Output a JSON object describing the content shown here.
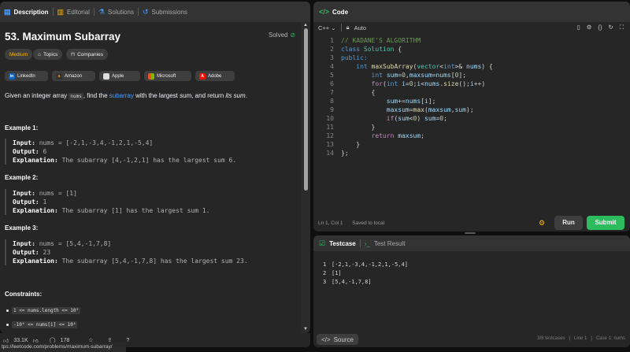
{
  "left_tabs": [
    {
      "label": "Description",
      "icon": "document-icon"
    },
    {
      "label": "Editorial",
      "icon": "book-icon"
    },
    {
      "label": "Solutions",
      "icon": "flask-icon"
    },
    {
      "label": "Submissions",
      "icon": "history-icon"
    }
  ],
  "problem": {
    "title": "53. Maximum Subarray",
    "status": "Solved",
    "difficulty": "Medium",
    "topics_label": "Topics",
    "companies_label": "Companies",
    "difficulty_color": "#ffb800"
  },
  "companies": [
    "LinkedIn",
    "Amazon",
    "Apple",
    "Microsoft",
    "Adobe"
  ],
  "statement": {
    "part1": "Given an integer array ",
    "code": "nums",
    "part2": ", find the ",
    "link": "subarray",
    "part3": " with the largest sum, and return ",
    "part4": "its sum",
    "part5": "."
  },
  "examples": [
    {
      "heading": "Example 1:",
      "input_label": "Input:",
      "input": "nums = [-2,1,-3,4,-1,2,1,-5,4]",
      "output_label": "Output:",
      "output": "6",
      "explanation_label": "Explanation:",
      "explanation": "The subarray [4,-1,2,1] has the largest sum 6."
    },
    {
      "heading": "Example 2:",
      "input_label": "Input:",
      "input": "nums = [1]",
      "output_label": "Output:",
      "output": "1",
      "explanation_label": "Explanation:",
      "explanation": "The subarray [1] has the largest sum 1."
    },
    {
      "heading": "Example 3:",
      "input_label": "Input:",
      "input": "nums = [5,4,-1,7,8]",
      "output_label": "Output:",
      "output": "23",
      "explanation_label": "Explanation:",
      "explanation": "The subarray [5,4,-1,7,8] has the largest sum 23."
    }
  ],
  "constraints": {
    "heading": "Constraints:",
    "items": [
      "1 <= nums.length <= 10⁵",
      "-10⁴ <= nums[i] <= 10⁴"
    ]
  },
  "footer": {
    "likes": "33.1K",
    "comments": "178"
  },
  "status_url": "tps://leetcode.com/problems/maximum-subarray/",
  "code_panel": {
    "tab_label": "Code",
    "language": "C++",
    "mode": "Auto",
    "status_pos": "Ln 1, Col 1",
    "status_saved": "Saved to local",
    "run_label": "Run",
    "submit_label": "Submit"
  },
  "code_lines": [
    "// KADANE'S ALGORITHM",
    "class Solution {",
    "public:",
    "    int maxSubArray(vector<int>& nums) {",
    "        int sum=0,maxsum=nums[0];",
    "        for(int i=0;i<nums.size();i++)",
    "        {",
    "            sum+=nums[i];",
    "            maxsum=max(maxsum,sum);",
    "            if(sum<0) sum=0;",
    "        }",
    "        return maxsum;",
    "    }",
    "};"
  ],
  "testcase_panel": {
    "tab_testcase": "Testcase",
    "tab_result": "Test Result",
    "lines": [
      "[-2,1,-3,4,-1,2,1,-5,4]",
      "[1]",
      "[5,4,-1,7,8]"
    ],
    "source_label": "Source",
    "info": [
      "3/8 testcases",
      "Line 1",
      "Case 1: nums"
    ]
  }
}
